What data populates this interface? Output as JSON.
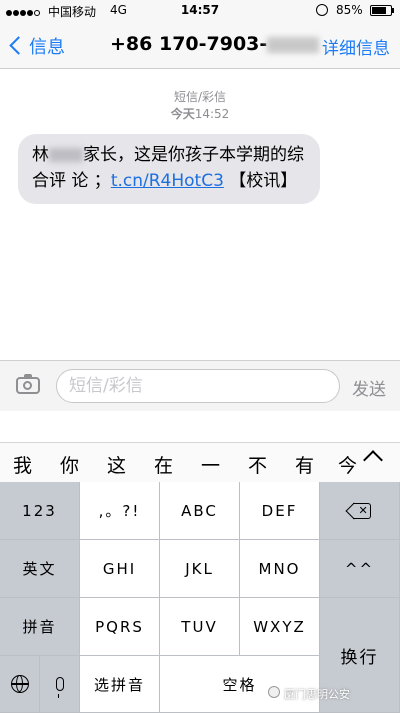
{
  "status_bar": {
    "carrier": "中国移动",
    "network": "4G",
    "time": "14:57",
    "battery": "85%",
    "battery_level": 0.85
  },
  "nav": {
    "back_label": "信息",
    "contact_prefix": "+86 170-7903-",
    "details_label": "详细信息"
  },
  "thread": {
    "service": "短信/彩信",
    "day": "今天",
    "time": "14:52",
    "message": {
      "part1": "林",
      "part2": "家长，这是你孩子本学期的综合评 论 ；",
      "link": "t.cn/R4HotC3",
      "part3": " 【校讯】"
    }
  },
  "input": {
    "placeholder": "短信/彩信",
    "send_label": "发送"
  },
  "candidates": [
    "我",
    "你",
    "这",
    "在",
    "一",
    "不",
    "有",
    "今"
  ],
  "keyboard": {
    "row1": [
      "123",
      ",。?!",
      "ABC",
      "DEF"
    ],
    "row2": [
      "英文",
      "GHI",
      "JKL",
      "MNO",
      "^^"
    ],
    "row3": [
      "拼音",
      "PQRS",
      "TUV",
      "WXYZ"
    ],
    "row4": [
      "选拼音",
      "空格"
    ],
    "return_label": "换行"
  },
  "watermark": "厦门思明公安",
  "icons": {
    "back": "chevron-left-icon",
    "camera": "camera-icon",
    "delete": "delete-icon",
    "globe": "globe-icon",
    "mic": "microphone-icon",
    "expand": "chevron-up-icon"
  },
  "colors": {
    "accent": "#1d7cf5",
    "bubble": "#e5e5ea",
    "keyboard_bg": "#d1d4d9"
  }
}
